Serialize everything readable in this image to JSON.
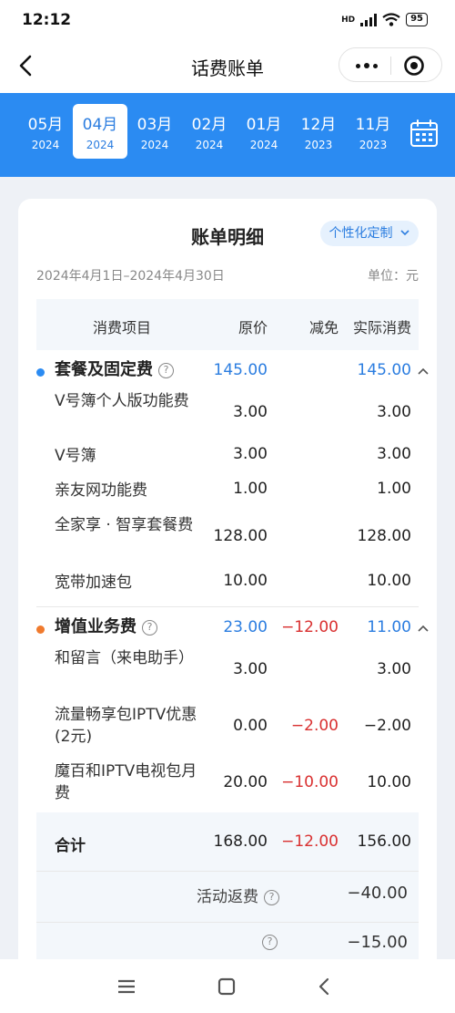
{
  "status": {
    "time": "12:12",
    "signal": "HD",
    "battery": "95"
  },
  "header": {
    "title": "话费账单"
  },
  "months": [
    {
      "label": "05月",
      "year": "2024",
      "active": false
    },
    {
      "label": "04月",
      "year": "2024",
      "active": true
    },
    {
      "label": "03月",
      "year": "2024",
      "active": false
    },
    {
      "label": "02月",
      "year": "2024",
      "active": false
    },
    {
      "label": "01月",
      "year": "2024",
      "active": false
    },
    {
      "label": "12月",
      "year": "2023",
      "active": false
    },
    {
      "label": "11月",
      "year": "2023",
      "active": false
    }
  ],
  "bill": {
    "title": "账单明细",
    "customize_label": "个性化定制",
    "date_range": "2024年4月1日–2024年4月30日",
    "unit": "单位：元",
    "columns": {
      "item": "消费项目",
      "original": "原价",
      "discount": "减免",
      "actual": "实际消费"
    },
    "categories": [
      {
        "name": "套餐及固定费",
        "original": "145.00",
        "discount": "",
        "actual": "145.00",
        "bullet_color": "#2b8bf2",
        "items": [
          {
            "name": "V号簿个人版功能费",
            "original": "3.00",
            "discount": "",
            "actual": "3.00"
          },
          {
            "name": "V号簿",
            "original": "3.00",
            "discount": "",
            "actual": "3.00"
          },
          {
            "name": "亲友网功能费",
            "original": "1.00",
            "discount": "",
            "actual": "1.00"
          },
          {
            "name": "全家享 · 智享套餐费",
            "original": "128.00",
            "discount": "",
            "actual": "128.00"
          },
          {
            "name": "宽带加速包",
            "original": "10.00",
            "discount": "",
            "actual": "10.00"
          }
        ]
      },
      {
        "name": "增值业务费",
        "original": "23.00",
        "discount": "−12.00",
        "actual": "11.00",
        "bullet_color": "#f07a2d",
        "items": [
          {
            "name": "和留言（来电助手）",
            "original": "3.00",
            "discount": "",
            "actual": "3.00"
          },
          {
            "name": "流量畅享包IPTV优惠(2元)",
            "original": "0.00",
            "discount": "−2.00",
            "actual": "−2.00"
          },
          {
            "name": "魔百和IPTV电视包月费",
            "original": "20.00",
            "discount": "−10.00",
            "actual": "10.00"
          }
        ]
      }
    ],
    "total": {
      "label": "合计",
      "original": "168.00",
      "discount": "−12.00",
      "actual": "156.00"
    },
    "rebate": {
      "label": "活动返费",
      "value": "−40.00"
    },
    "extra": {
      "label": "",
      "value": "−15.00"
    }
  }
}
